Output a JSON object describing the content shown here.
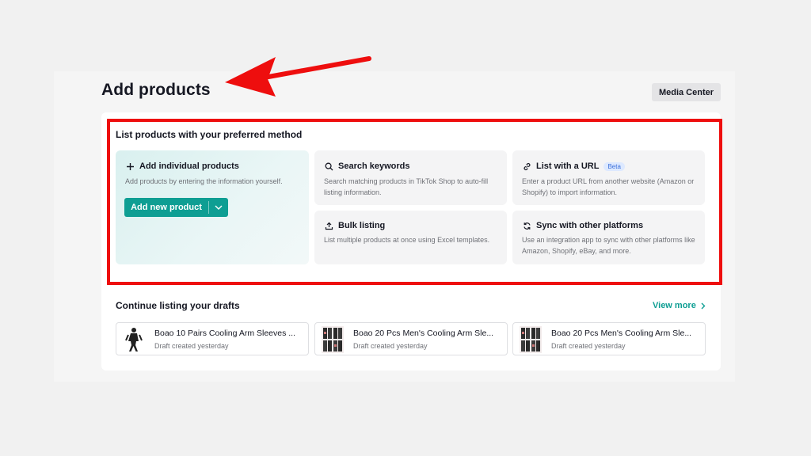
{
  "header": {
    "title": "Add products",
    "media_center_label": "Media Center"
  },
  "methods_section": {
    "title": "List products with your preferred method",
    "methods": [
      {
        "title": "Add individual products",
        "description": "Add products by entering the information yourself.",
        "icon": "plus-icon",
        "button_label": "Add new product"
      },
      {
        "title": "Search keywords",
        "description": "Search matching products in TikTok Shop to auto-fill listing information.",
        "icon": "search-icon"
      },
      {
        "title": "List with a URL",
        "badge": "Beta",
        "description": "Enter a product URL from another website (Amazon or Shopify) to import information.",
        "icon": "link-icon"
      },
      {
        "title": "Bulk listing",
        "description": "List multiple products at once using Excel templates.",
        "icon": "upload-icon"
      },
      {
        "title": "Sync with other platforms",
        "description": "Use an integration app to sync with other platforms like Amazon, Shopify, eBay, and more.",
        "icon": "sync-icon"
      }
    ]
  },
  "drafts_section": {
    "title": "Continue listing your drafts",
    "view_more_label": "View more",
    "drafts": [
      {
        "name": "Boao 10 Pairs Cooling Arm Sleeves ...",
        "status": "Draft created yesterday"
      },
      {
        "name": "Boao 20 Pcs Men's Cooling Arm Sle...",
        "status": "Draft created yesterday"
      },
      {
        "name": "Boao 20 Pcs Men's Cooling Arm Sle...",
        "status": "Draft created yesterday"
      }
    ]
  },
  "colors": {
    "accent": "#0e9e93",
    "annotation_red": "#ee0e0e",
    "beta_badge": "#3b6fd9"
  }
}
